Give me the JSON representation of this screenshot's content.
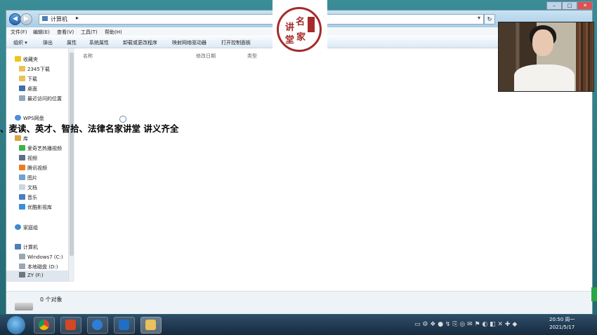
{
  "window": {
    "address": "计算机",
    "menu": [
      "文件(F)",
      "编辑(E)",
      "查看(V)",
      "工具(T)",
      "帮助(H)"
    ],
    "toolbar": [
      "组织 ▾",
      "弹出",
      "属性",
      "系统属性",
      "卸载或更改程序",
      "映射网络驱动器",
      "打开控制面板"
    ],
    "columns": [
      "名称",
      "修改日期",
      "类型"
    ]
  },
  "sidebar": {
    "favorites": "收藏夹",
    "fav_items": [
      "2345下载",
      "下载",
      "桌面",
      "最近访问的位置"
    ],
    "wps": "WPS网盘",
    "library": "库",
    "lib_items": [
      "爱奇艺热播视频",
      "视频",
      "腾讯视频",
      "图片",
      "文档",
      "音乐",
      "优酷影视库"
    ],
    "homegroup": "家庭组",
    "computer": "计算机",
    "drives": [
      "Windows7 (C:)",
      "本地磁盘 (D:)",
      "ZY (F:)"
    ]
  },
  "status": {
    "count": "0 个对象"
  },
  "overlay_text": "、麦读、英才、智拾、法律名家讲堂 讲义齐全",
  "logo_chars": [
    "讲",
    "名",
    "堂",
    "家"
  ],
  "clock": {
    "time": "20:50 周一",
    "date": "2021/5/17"
  },
  "colors": {
    "accent": "#2366b3",
    "logo_red": "#a52a2a",
    "taskbar": "#1f3a54"
  }
}
